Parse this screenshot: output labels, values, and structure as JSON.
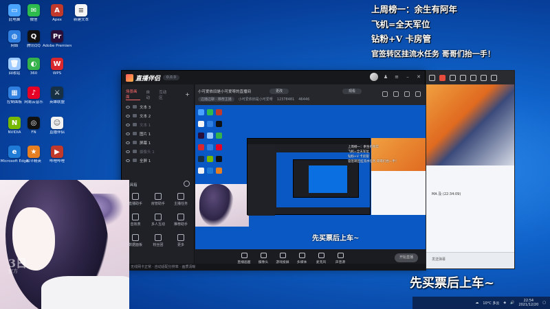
{
  "desktop": {
    "icons": [
      {
        "label": "此电脑",
        "color": "#4aa3ff",
        "glyph": "▭"
      },
      {
        "label": "微信",
        "color": "#2dbb4e",
        "glyph": "✉"
      },
      {
        "label": "Apex",
        "color": "#c0392b",
        "glyph": "A"
      },
      {
        "label": "新建文本",
        "color": "#f5f5f5",
        "glyph": "≡"
      },
      {
        "label": "网络",
        "color": "#2f7fe0",
        "glyph": "◍"
      },
      {
        "label": "腾讯QQ",
        "color": "#111111",
        "glyph": "Q"
      },
      {
        "label": "Adobe Premiere",
        "color": "#2a0f3a",
        "glyph": "Pr"
      },
      {
        "label": "回收站",
        "color": "#9cc9ff",
        "glyph": "🗑"
      },
      {
        "label": "360",
        "color": "#35b34a",
        "glyph": "◐"
      },
      {
        "label": "WPS",
        "color": "#d9272e",
        "glyph": "W"
      },
      {
        "label": "控制面板",
        "color": "#2f7fe0",
        "glyph": "▦"
      },
      {
        "label": "网易云音乐",
        "color": "#e60026",
        "glyph": "♪"
      },
      {
        "label": "英雄联盟",
        "color": "#183044",
        "glyph": "⚔"
      },
      {
        "label": "NVIDIA",
        "color": "#76b900",
        "glyph": "N"
      },
      {
        "label": "FN",
        "color": "#111111",
        "glyph": "◎"
      },
      {
        "label": "直播伴侣",
        "color": "#f2f2f2",
        "glyph": "☺"
      },
      {
        "label": "Microsoft Edge",
        "color": "#1f7ad6",
        "glyph": "e"
      },
      {
        "label": "和平精英",
        "color": "#e67e22",
        "glyph": "★"
      },
      {
        "label": "哔哩哔哩",
        "color": "#c0392b",
        "glyph": "▶"
      }
    ]
  },
  "overlay": {
    "lines": [
      "上周榜一：余生有阿年",
      "飞机=全天军位",
      "钻粉+V 卡房管",
      "官签转区挂流水任务 哥哥们抬一手！"
    ],
    "cta": "先买票后上车~"
  },
  "app": {
    "title": "直播伴侣",
    "version": "0.0.0",
    "left_tabs": [
      "场景画面",
      "自动",
      "互动区"
    ],
    "scenes": [
      "文本 3",
      "文本 2",
      "文本 1",
      "图片 1",
      "屏幕 1",
      "摄像头 1",
      "全屏 1"
    ],
    "tools_header": "工具箱",
    "tools": [
      "直播助手",
      "房管助手",
      "主播任务",
      "音效表",
      "多人互动",
      "推荐助手",
      "数据面板",
      "粉丝团",
      "更多"
    ],
    "room_title": "小可爱依旧是小可爱呀的直播间",
    "pill_a": "更改",
    "pill_b": "观看",
    "meta": [
      "边播边聊 · 推荐主播",
      "小可爱依旧是小可爱呀",
      "12378481",
      "46446"
    ],
    "bottom_buttons": [
      "直播画面",
      "摄像头",
      "游戏投屏",
      "多媒体",
      "麦克风",
      "声音源"
    ],
    "start_label": "开始直播",
    "status_text": "无线网卡正常 · 自动适配分辨率 · 画质清晰"
  },
  "right_panel": {
    "chat_line": "MA 及 (22:34:09)",
    "footer": "发送弹幕"
  },
  "taskbar": {
    "weather": "10°C 多云",
    "time": "22:54",
    "date": "2021/12/20"
  },
  "cam": {
    "watermark": "3日",
    "watermark_sub": "官方"
  }
}
